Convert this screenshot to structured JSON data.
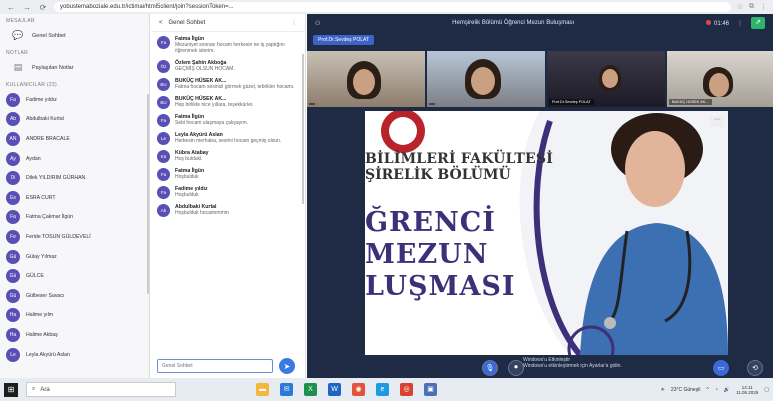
{
  "browser": {
    "url": "yobustemaboziale.edu.tr/ictimai/html5client/join?sessionToken=...",
    "back_icon": "←",
    "forward_icon": "→",
    "reload_icon": "⟳"
  },
  "left_panel": {
    "messages_title": "MESAJLAR",
    "general_chat": "Genel Sohbet",
    "notes_title": "NOTLAR",
    "shared_notes": "Paylaşılan Notlar",
    "shared_notes_sub": "",
    "users_title": "KULLANICILAR (23)",
    "users": [
      {
        "initials": "Fa",
        "name": "Fadime yıldız"
      },
      {
        "initials": "Ab",
        "name": "Abdulbaki Kurtal"
      },
      {
        "initials": "AN",
        "name": "ANDRE BRACALE"
      },
      {
        "initials": "Ay",
        "name": "Aydan"
      },
      {
        "initials": "Di",
        "name": "Dilek YILDIRIM GÜRHAN"
      },
      {
        "initials": "Es",
        "name": "ESRA CURT"
      },
      {
        "initials": "Fa",
        "name": "Fatma Çakmar İlgün"
      },
      {
        "initials": "Fe",
        "name": "Feride TOSUN GÜLDEVELİ"
      },
      {
        "initials": "Gü",
        "name": "Gülay Yılmaz"
      },
      {
        "initials": "Gü",
        "name": "GÜLCE"
      },
      {
        "initials": "Gü",
        "name": "Gülbeser Savacı"
      },
      {
        "initials": "Ha",
        "name": "Halime yılm"
      },
      {
        "initials": "Ha",
        "name": "Halime Akbaş"
      },
      {
        "initials": "Le",
        "name": "Leyla Akyürü Aslan"
      }
    ]
  },
  "chat": {
    "header": "Genel Sohbet",
    "back_icon": "<",
    "input_placeholder": "Genel Sohbet",
    "messages": [
      {
        "initials": "Fa",
        "author": "Fatma İlgün",
        "time": "",
        "text": "Mezuniyet sonrası hocam herkesin ne iş yaptığını öğrenmek isterim."
      },
      {
        "initials": "Öz",
        "author": "Özlem Şahin Akboğa",
        "time": "",
        "text": "GEÇMİŞ OLSUN HOCAM."
      },
      {
        "initials": "BU",
        "author": "BUKÜÇ HÜSEK AK...",
        "time": "",
        "text": "Fatma hocam sesinizi görmek güzel, tebrikler hocamı."
      },
      {
        "initials": "BU",
        "author": "BUKÜÇ HÜSEK AK...",
        "time": "",
        "text": "Hep birlikte nice yıllara, teşekkürler."
      },
      {
        "initials": "Fa",
        "author": "Fatma İlgün",
        "time": "",
        "text": "Sebi hocam ulaşmaya çalışayım."
      },
      {
        "initials": "Le",
        "author": "Leyla Akyürü Aslan",
        "time": "",
        "text": "Herkesin merhaba, sesimi hocam geçmiş olsun."
      },
      {
        "initials": "Kü",
        "author": "Kübra Atabay",
        "time": "",
        "text": "Hoş buldukl."
      },
      {
        "initials": "Fa",
        "author": "Fatma İlgün",
        "time": "",
        "text": "Hoşbulduk"
      },
      {
        "initials": "Fa",
        "author": "Fadime yıldız",
        "time": "",
        "text": "Hoşbulduk"
      },
      {
        "initials": "Ab",
        "author": "Abdulbaki Kurtal",
        "time": "",
        "text": "Hoşbulduk hocamımmm"
      }
    ]
  },
  "meeting": {
    "title": "Hemşirelik Bölümü Öğrenci Mezun Buluşması",
    "timer": "01:46",
    "speaker": "Prof.Dr.Sevdeş POLAT",
    "tiles": [
      {
        "name": ""
      },
      {
        "name": ""
      },
      {
        "name": "Prof.Dr.Sevdeş POLAT"
      },
      {
        "name": "BUKÜÇ HÜSEK AK..."
      }
    ],
    "poster": {
      "line1": "BİLİMLERİ FAKÜLTESİ",
      "line2": "ŞİRELİK BÖLÜMÜ",
      "big1": "ĞRENCİ",
      "big2": "MEZUN",
      "big3": "LUŞMASI",
      "url": "",
      "more": "⋯"
    },
    "watermark_line1": "Windows'u Etkinleştir",
    "watermark_line2": "Windows'u etkinleştirmek için Ayarlar'a gidin."
  },
  "taskbar": {
    "search_placeholder": "Ara",
    "weather": "23°C Güneşli",
    "time": "14:11",
    "date": "11.05.2025"
  },
  "colors": {
    "accent": "#3a6ad8",
    "avatar": "#5a4fb5",
    "meeting_bg": "#1f2a44",
    "poster_text": "#3e2f79"
  }
}
